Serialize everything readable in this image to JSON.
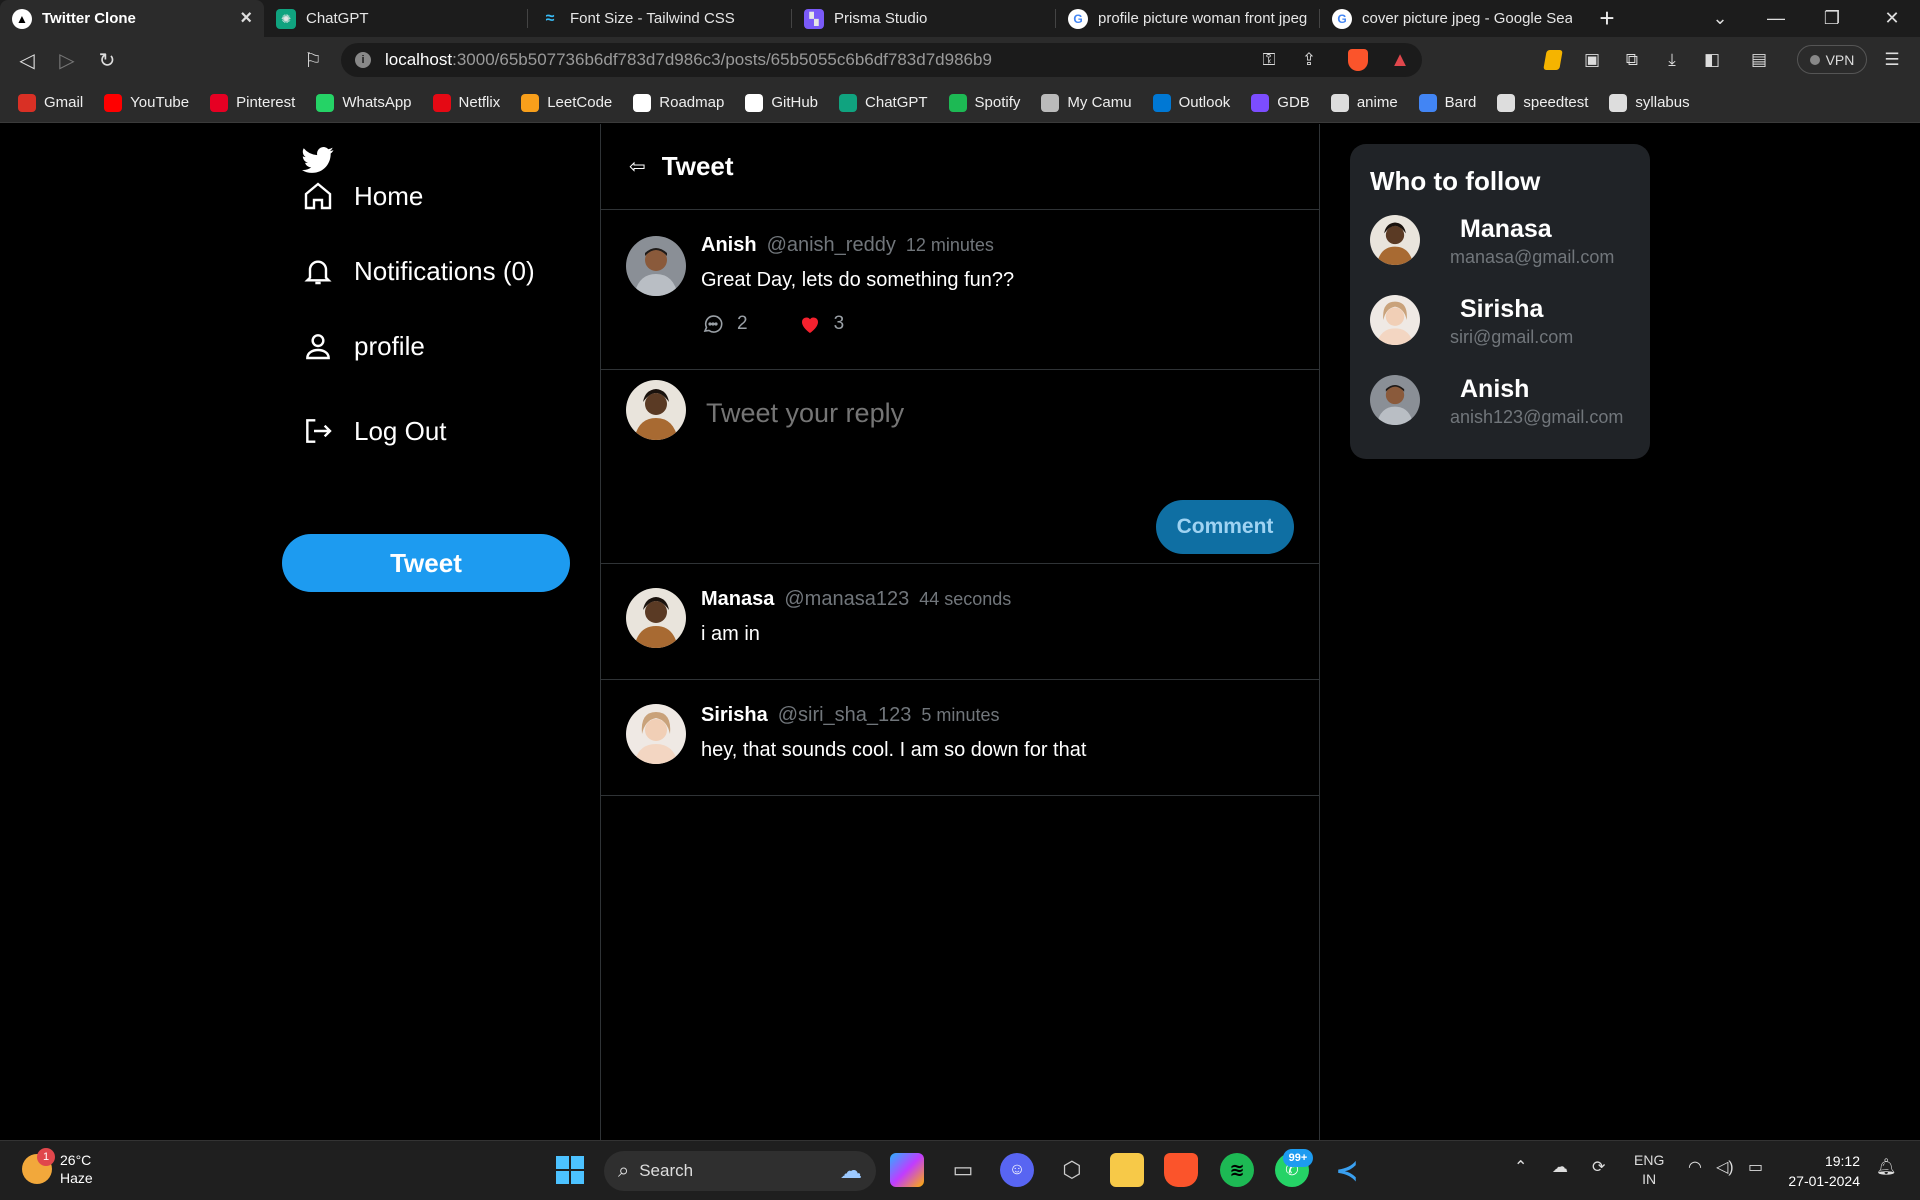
{
  "browser": {
    "tabs": [
      {
        "title": "Twitter Clone",
        "icon": "twitter-clone-favicon",
        "active": true
      },
      {
        "title": "ChatGPT",
        "icon": "chatgpt-icon"
      },
      {
        "title": "Font Size - Tailwind CSS",
        "icon": "tailwind-icon"
      },
      {
        "title": "Prisma Studio",
        "icon": "prisma-icon"
      },
      {
        "title": "profile picture woman front jpeg",
        "icon": "google-icon"
      },
      {
        "title": "cover picture jpeg - Google Sear",
        "icon": "google-icon"
      }
    ],
    "url_host": "localhost",
    "url_path": ":3000/65b507736b6df783d7d986c3/posts/65b5055c6b6df783d7d986b9",
    "vpn_label": "VPN",
    "bookmarks": [
      {
        "label": "Gmail",
        "color": "#d93025"
      },
      {
        "label": "YouTube",
        "color": "#ff0000"
      },
      {
        "label": "Pinterest",
        "color": "#e60023"
      },
      {
        "label": "WhatsApp",
        "color": "#25d366"
      },
      {
        "label": "Netflix",
        "color": "#e50914"
      },
      {
        "label": "LeetCode",
        "color": "#f89f1b"
      },
      {
        "label": "Roadmap",
        "color": "#ffffff"
      },
      {
        "label": "GitHub",
        "color": "#ffffff"
      },
      {
        "label": "ChatGPT",
        "color": "#10a37f"
      },
      {
        "label": "Spotify",
        "color": "#1db954"
      },
      {
        "label": "My Camu",
        "color": "#bbbbbb"
      },
      {
        "label": "Outlook",
        "color": "#0078d4"
      },
      {
        "label": "GDB",
        "color": "#7c4dff"
      },
      {
        "label": "anime",
        "color": "#dddddd"
      },
      {
        "label": "Bard",
        "color": "#4285f4"
      },
      {
        "label": "speedtest",
        "color": "#dddddd"
      },
      {
        "label": "syllabus",
        "color": "#dddddd"
      }
    ]
  },
  "sidebar": {
    "items": [
      {
        "label": "Home",
        "icon": "home-icon"
      },
      {
        "label": "Notifications (0)",
        "icon": "bell-icon"
      },
      {
        "label": "profile",
        "icon": "user-icon"
      },
      {
        "label": "Log Out",
        "icon": "logout-icon"
      }
    ],
    "tweet_button": "Tweet"
  },
  "main": {
    "title": "Tweet",
    "post": {
      "name": "Anish",
      "handle": "@anish_reddy",
      "time": "12 minutes",
      "text": "Great Day, lets do something fun??",
      "comments": "2",
      "likes": "3"
    },
    "reply": {
      "placeholder": "Tweet your reply",
      "button": "Comment"
    },
    "comments": [
      {
        "name": "Manasa",
        "handle": "@manasa123",
        "time": "44 seconds",
        "text": "i am in"
      },
      {
        "name": "Sirisha",
        "handle": "@siri_sha_123",
        "time": "5 minutes",
        "text": "hey, that sounds cool. I am so down for that"
      }
    ]
  },
  "who_to_follow": {
    "title": "Who to follow",
    "users": [
      {
        "name": "Manasa",
        "email": "manasa@gmail.com"
      },
      {
        "name": "Sirisha",
        "email": "siri@gmail.com"
      },
      {
        "name": "Anish",
        "email": "anish123@gmail.com"
      }
    ]
  },
  "taskbar": {
    "weather_temp": "26°C",
    "weather_desc": "Haze",
    "weather_badge": "1",
    "search_label": "Search",
    "whatsapp_badge": "99+",
    "lang_line1": "ENG",
    "lang_line2": "IN",
    "time": "19:12",
    "date": "27-01-2024"
  }
}
